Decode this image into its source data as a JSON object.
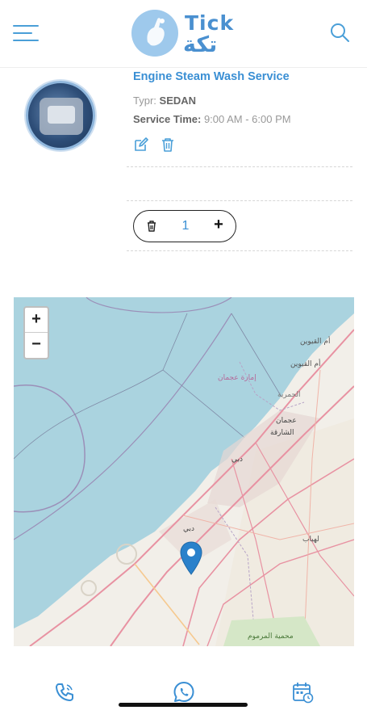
{
  "header": {
    "logo_text_en": "Tick",
    "logo_text_ar": "تكة",
    "menu_icon": "hamburger-menu-icon",
    "search_icon": "search-icon"
  },
  "service": {
    "title": "Engine Steam Wash Service",
    "type_label": "Typr:",
    "type_value": "SEDAN",
    "time_label": "Service Time:",
    "time_value": "9:00 AM - 6:00 PM",
    "image_icon": "engine-photo"
  },
  "cart": {
    "quantity": "1",
    "add_label": "+"
  },
  "map": {
    "zoom_in_label": "+",
    "zoom_out_label": "−",
    "labels": {
      "al_quoz_north": "أم القيوين",
      "umm_al_quwain": "أم القيوين",
      "ajman_emirate": "إمارة عجمان",
      "hamriyah": "الحمرية",
      "ajman": "عجمان",
      "sharjah": "الشارقة",
      "dubai": "دبي",
      "dubai_south": "دبي",
      "lahbab": "لهباب",
      "marmoom": "محمية المرموم"
    }
  },
  "bottom_nav": {
    "items": [
      {
        "icon": "phone-icon"
      },
      {
        "icon": "whatsapp-icon"
      },
      {
        "icon": "calendar-icon"
      }
    ]
  },
  "colors": {
    "accent": "#3a8fd4",
    "sea": "#aad3df",
    "land": "#f2efe9",
    "road": "#e892a2"
  }
}
